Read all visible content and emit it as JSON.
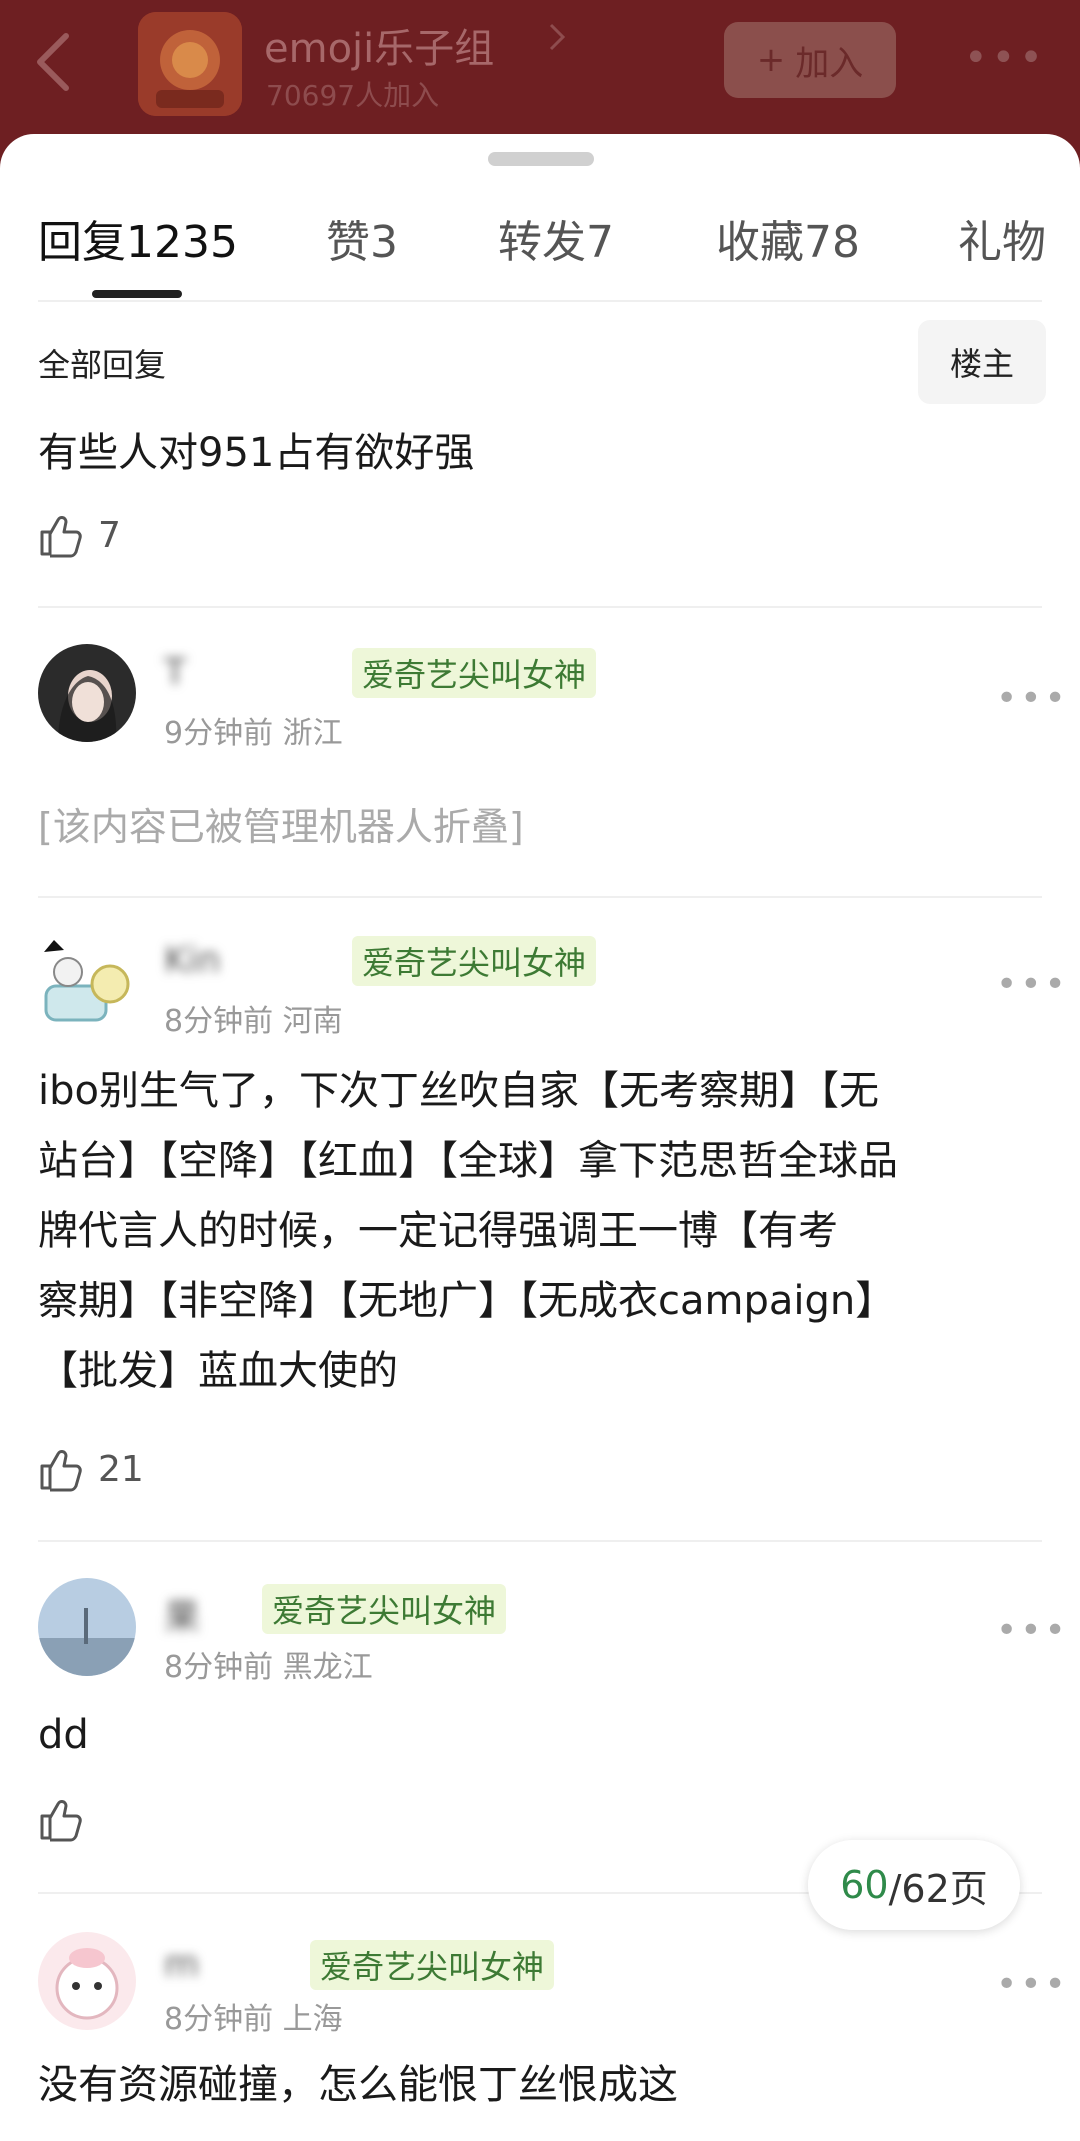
{
  "header": {
    "group_name": "emoji乐子组",
    "group_members": "70697人加入",
    "join_label": "加入",
    "join_icon": "plus-icon"
  },
  "tabs": [
    {
      "label": "回复1235"
    },
    {
      "label": "赞3"
    },
    {
      "label": "转发7"
    },
    {
      "label": "收藏78"
    },
    {
      "label": "礼物"
    }
  ],
  "section": {
    "all_replies": "全部回复",
    "owner_filter": "楼主"
  },
  "top_post": {
    "text": "有些人对951占有欲好强",
    "likes": "7"
  },
  "replies": [
    {
      "username": "T",
      "badge": "爱奇艺尖叫女神",
      "time": "9分钟前",
      "location": "浙江",
      "text": "[该内容已被管理机器人折叠]",
      "likes": ""
    },
    {
      "username": "Kin",
      "badge": "爱奇艺尖叫女神",
      "time": "8分钟前",
      "location": "河南",
      "text_lines": [
        "ibo别生气了，下次丁丝吹自家【无考察期】【无",
        "站台】【空降】【红血】【全球】拿下范思哲全球品",
        "牌代言人的时候，一定记得强调王一博【有考",
        "察期】【非空降】【无地广】【无成衣campaign】",
        "【批发】蓝血大使的"
      ],
      "likes": "21"
    },
    {
      "username": "果",
      "badge": "爱奇艺尖叫女神",
      "time": "8分钟前",
      "location": "黑龙江",
      "text": "dd",
      "likes": ""
    },
    {
      "username": "m",
      "badge": "爱奇艺尖叫女神",
      "time": "8分钟前",
      "location": "上海",
      "text": "没有资源碰撞，怎么能恨丁丝恨成这"
    }
  ],
  "pagination": {
    "current": "60",
    "rest": "/62页"
  },
  "colors": {
    "header_bg": "#6e1f22",
    "badge_green": "#3d7a34",
    "page_green": "#2f8a4a"
  }
}
